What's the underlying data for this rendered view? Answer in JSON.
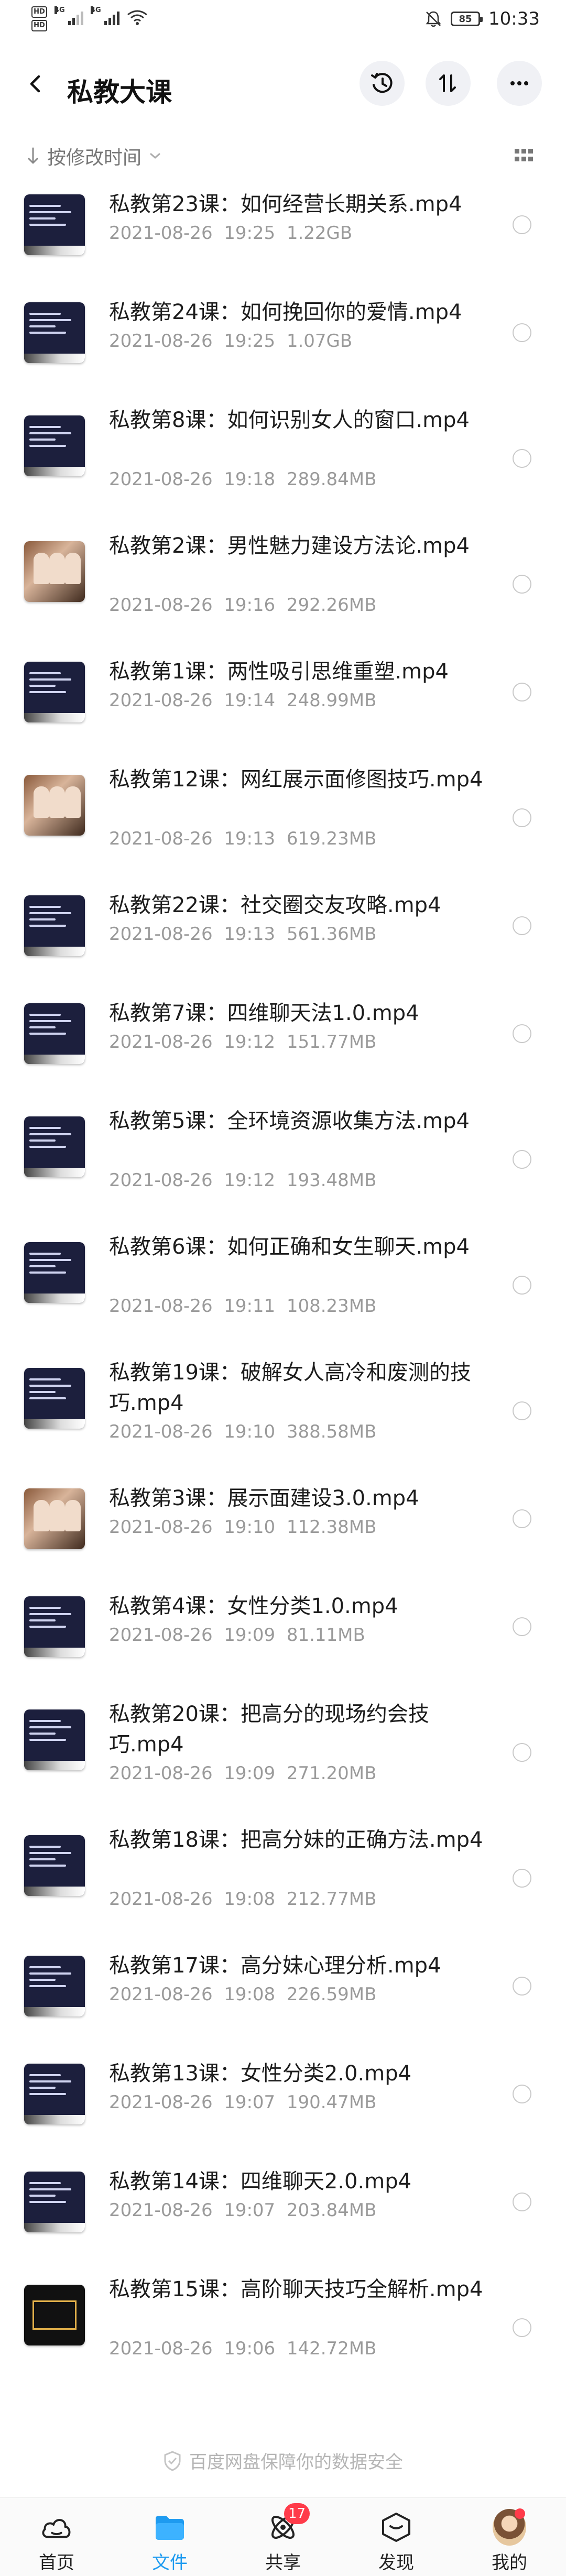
{
  "status_bar": {
    "sim1": "HD",
    "sim2": "HD",
    "net1": "4G",
    "net2": "4G",
    "battery": "85",
    "time": "10:33"
  },
  "header": {
    "title": "私教大课"
  },
  "sort": {
    "label": "按修改时间"
  },
  "files": [
    {
      "name": "私教第23课：如何经营长期关系.mp4",
      "date": "2021-08-26  19:25",
      "size": "1.22GB",
      "thumb": "slide"
    },
    {
      "name": "私教第24课：如何挽回你的爱情.mp4",
      "date": "2021-08-26  19:25",
      "size": "1.07GB",
      "thumb": "space"
    },
    {
      "name": "私教第8课：如何识别女人的窗口.mp4",
      "date": "2021-08-26  19:18",
      "size": "289.84MB",
      "thumb": "slide"
    },
    {
      "name": "私教第2课：男性魅力建设方法论.mp4",
      "date": "2021-08-26  19:16",
      "size": "292.26MB",
      "thumb": "photo"
    },
    {
      "name": "私教第1课：两性吸引思维重塑.mp4",
      "date": "2021-08-26  19:14",
      "size": "248.99MB",
      "thumb": "slide"
    },
    {
      "name": "私教第12课：网红展示面修图技巧.mp4",
      "date": "2021-08-26  19:13",
      "size": "619.23MB",
      "thumb": "photo"
    },
    {
      "name": "私教第22课：社交圈交友攻略.mp4",
      "date": "2021-08-26  19:13",
      "size": "561.36MB",
      "thumb": "slide"
    },
    {
      "name": "私教第7课：四维聊天法1.0.mp4",
      "date": "2021-08-26  19:12",
      "size": "151.77MB",
      "thumb": "slide"
    },
    {
      "name": "私教第5课：全环境资源收集方法.mp4",
      "date": "2021-08-26  19:12",
      "size": "193.48MB",
      "thumb": "slide"
    },
    {
      "name": "私教第6课：如何正确和女生聊天.mp4",
      "date": "2021-08-26  19:11",
      "size": "108.23MB",
      "thumb": "slide"
    },
    {
      "name": "私教第19课：破解女人高冷和废测的技巧.mp4",
      "date": "2021-08-26  19:10",
      "size": "388.58MB",
      "thumb": "slide"
    },
    {
      "name": "私教第3课：展示面建设3.0.mp4",
      "date": "2021-08-26  19:10",
      "size": "112.38MB",
      "thumb": "photo"
    },
    {
      "name": "私教第4课：女性分类1.0.mp4",
      "date": "2021-08-26  19:09",
      "size": "81.11MB",
      "thumb": "slide"
    },
    {
      "name": "私教第20课：把高分的现场约会技巧.mp4",
      "date": "2021-08-26  19:09",
      "size": "271.20MB",
      "thumb": "slide"
    },
    {
      "name": "私教第18课：把高分妹的正确方法.mp4",
      "date": "2021-08-26  19:08",
      "size": "212.77MB",
      "thumb": "slide"
    },
    {
      "name": "私教第17课：高分妹心理分析.mp4",
      "date": "2021-08-26  19:08",
      "size": "226.59MB",
      "thumb": "slide"
    },
    {
      "name": "私教第13课：女性分类2.0.mp4",
      "date": "2021-08-26  19:07",
      "size": "190.47MB",
      "thumb": "slide"
    },
    {
      "name": "私教第14课：四维聊天2.0.mp4",
      "date": "2021-08-26  19:07",
      "size": "203.84MB",
      "thumb": "slide"
    },
    {
      "name": "私教第15课：高阶聊天技巧全解析.mp4",
      "date": "2021-08-26  19:06",
      "size": "142.72MB",
      "thumb": "black"
    }
  ],
  "footer_note": "百度网盘保障你的数据安全",
  "nav": {
    "home": "首页",
    "files": "文件",
    "share": "共享",
    "share_badge": "17",
    "discover": "发现",
    "mine": "我的"
  },
  "colors": {
    "accent": "#1e9bf0",
    "badge": "#ff3b4a"
  }
}
